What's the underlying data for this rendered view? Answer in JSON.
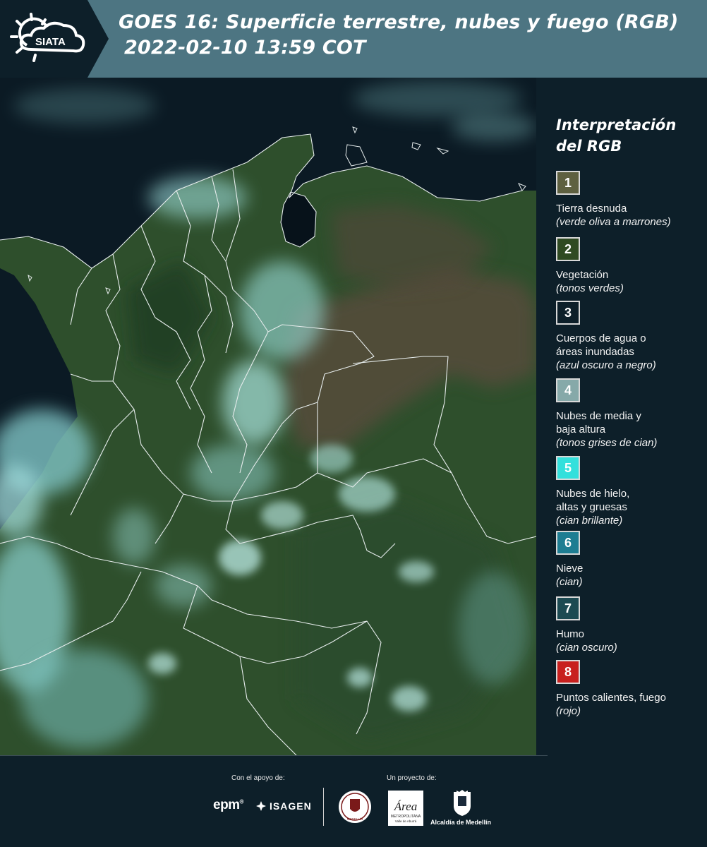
{
  "header": {
    "logo_text": "SIATA",
    "title_line1": "GOES 16: Superficie terrestre, nubes y fuego (RGB)",
    "title_line2": "2022-02-10 13:59 COT"
  },
  "legend": {
    "title_line1": "Interpretación",
    "title_line2": "del RGB",
    "items": [
      {
        "number": "1",
        "color": "#5e6040",
        "line1": "Tierra desnuda",
        "line2": "",
        "sub": "(verde oliva a marrones)"
      },
      {
        "number": "2",
        "color": "#2f4a22",
        "line1": "Vegetación",
        "line2": "",
        "sub": "(tonos verdes)"
      },
      {
        "number": "3",
        "color": "#0d1f29",
        "line1": "Cuerpos de agua o",
        "line2": "áreas inundadas",
        "sub": "(azul oscuro a negro)"
      },
      {
        "number": "4",
        "color": "#86a9a9",
        "line1": "Nubes de media y",
        "line2": "baja altura",
        "sub": "(tonos grises de cian)"
      },
      {
        "number": "5",
        "color": "#33e0dc",
        "line1": "Nubes de hielo,",
        "line2": "altas y gruesas",
        "sub": "(cian brillante)"
      },
      {
        "number": "6",
        "color": "#1e7d92",
        "line1": "Nieve",
        "line2": "",
        "sub": "(cian)"
      },
      {
        "number": "7",
        "color": "#1c4a52",
        "line1": "Humo",
        "line2": "",
        "sub": "(cian oscuro)"
      },
      {
        "number": "8",
        "color": "#c8201e",
        "line1": "Puntos calientes, fuego",
        "line2": "",
        "sub": "(rojo)"
      }
    ]
  },
  "footer": {
    "support_label": "Con el apoyo de:",
    "project_label": "Un proyecto de:",
    "sponsor1": "epm",
    "sponsor1_mark": "®",
    "sponsor2": "ISAGEN",
    "partner_metro": "Área",
    "partner_metro_sub1": "METROPOLITANA",
    "partner_metro_sub2": "Valle de Aburrá",
    "partner_alcaldia": "Alcaldía de Medellín",
    "seal_text": "MEDELLÍN"
  },
  "colors": {
    "header_dark": "#0d1f29",
    "header_band": "#4d7582",
    "water": "#0b1a24",
    "vegetation": "#2e4f2c",
    "bare_soil": "#5b4c3c",
    "cloud_cyan": "#8fd9d6",
    "ice_cyan": "#baf4f0",
    "border_line": "#e6ecec"
  }
}
